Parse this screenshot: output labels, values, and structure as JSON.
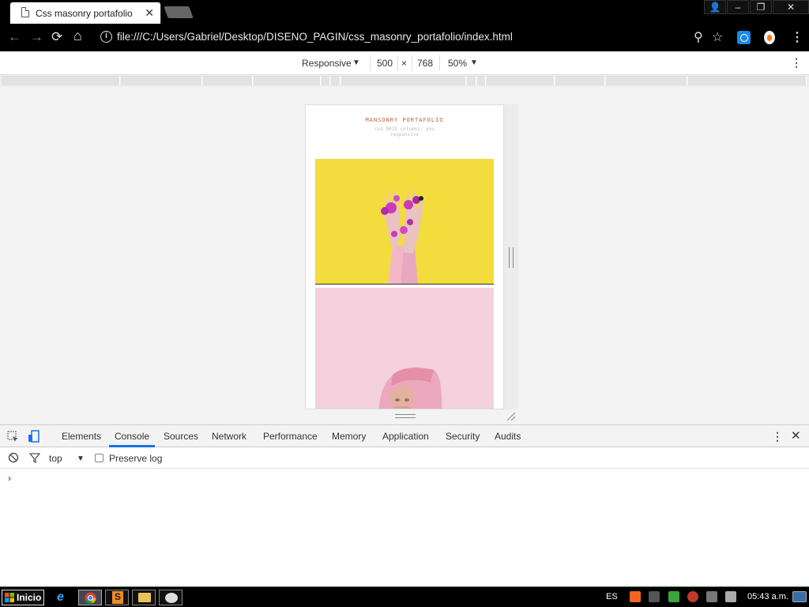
{
  "browser": {
    "tab_title": "Css masonry portafolio",
    "url": "file:///C:/Users/Gabriel/Desktop/DISENO_PAGIN/css_masonry_portafolio/index.html"
  },
  "device_toolbar": {
    "mode": "Responsive",
    "width": "500",
    "separator": "×",
    "height": "768",
    "zoom": "50%"
  },
  "page": {
    "title": "MANSONRY PORTAFOLIO",
    "subtitle": "css GRID columns, you responsive"
  },
  "devtools": {
    "tabs": [
      "Elements",
      "Console",
      "Sources",
      "Network",
      "Performance",
      "Memory",
      "Application",
      "Security",
      "Audits"
    ],
    "active_tab": "Console",
    "context": "top",
    "preserve_log_label": "Preserve log",
    "prompt": "›"
  },
  "taskbar": {
    "start_label": "Inicio",
    "language": "ES",
    "clock": "05:43 a.m."
  },
  "colors": {
    "accent_blue": "#1a73e8",
    "photo1_bg": "#f3dc3d",
    "photo2_bg": "#f4d1dc",
    "site_title": "#b4663a"
  }
}
